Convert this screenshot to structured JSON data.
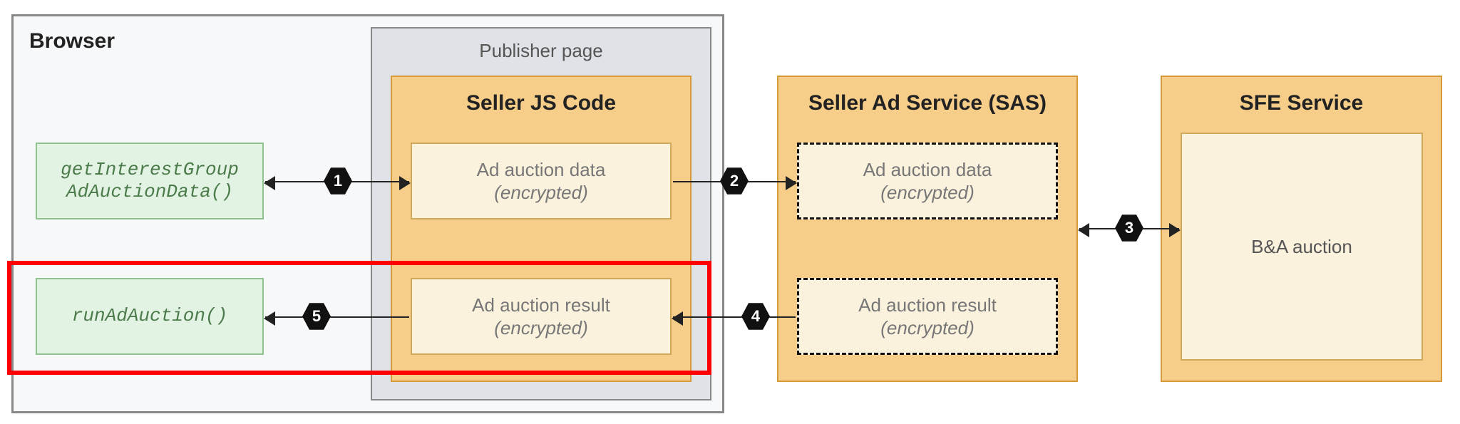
{
  "browser": {
    "title": "Browser"
  },
  "publisher": {
    "title": "Publisher page"
  },
  "sellerJs": {
    "title": "Seller JS Code",
    "adData": {
      "line1": "Ad auction data",
      "line2": "(encrypted)"
    },
    "adResult": {
      "line1": "Ad auction result",
      "line2": "(encrypted)"
    }
  },
  "sas": {
    "title": "Seller Ad Service (SAS)",
    "adData": {
      "line1": "Ad auction data",
      "line2": "(encrypted)"
    },
    "adResult": {
      "line1": "Ad auction result",
      "line2": "(encrypted)"
    }
  },
  "sfe": {
    "title": "SFE Service",
    "content": "B&A auction"
  },
  "api": {
    "get": "getInterestGroup\nAdAuctionData()",
    "run": "runAdAuction()"
  },
  "steps": {
    "s1": "1",
    "s2": "2",
    "s3": "3",
    "s4": "4",
    "s5": "5"
  }
}
